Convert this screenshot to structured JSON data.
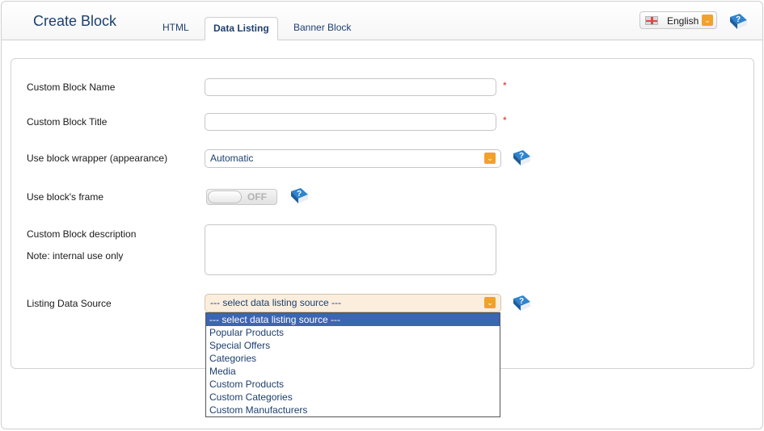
{
  "header": {
    "title": "Create Block",
    "tabs": [
      {
        "label": "HTML"
      },
      {
        "label": "Data Listing"
      },
      {
        "label": "Banner Block"
      }
    ],
    "language": "English"
  },
  "form": {
    "name_label": "Custom Block Name",
    "title_label": "Custom Block Title",
    "required_mark": "*",
    "wrapper_label": "Use block wrapper (appearance)",
    "wrapper_value": "Automatic",
    "frame_label": "Use block's frame",
    "frame_toggle": "OFF",
    "desc_label": "Custom Block description",
    "desc_note": "Note: internal use only",
    "source_label": "Listing Data Source",
    "source_value": "--- select data listing source ---",
    "source_options": [
      "--- select data listing source ---",
      "Popular Products",
      "Special Offers",
      "Categories",
      "Media",
      "Custom Products",
      "Custom Categories",
      "Custom Manufacturers"
    ]
  },
  "colors": {
    "accent": "#f0a22c",
    "title": "#1d3f6e",
    "selected_option": "#3b66b0",
    "required": "#e02020"
  },
  "icons": [
    "flag-uk-icon",
    "chevron-down-icon",
    "help-book-icon"
  ]
}
